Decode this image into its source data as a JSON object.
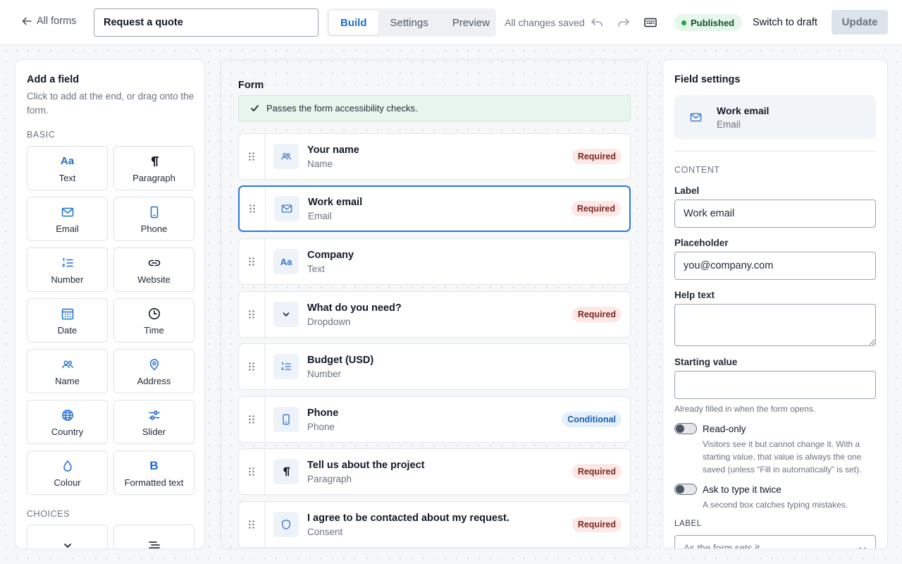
{
  "topbar": {
    "back_label": "All forms",
    "form_title": "Request a quote",
    "tabs": [
      {
        "label": "Build"
      },
      {
        "label": "Settings"
      },
      {
        "label": "Preview"
      }
    ],
    "save_status": "All changes saved",
    "status_badge": "Published",
    "draft_label": "Switch to draft",
    "update_label": "Update"
  },
  "colors": {
    "accent": "#1d6fd1",
    "published": "#22a34a",
    "required_bg": "#fde8e6",
    "conditional_bg": "#e6f0fb"
  },
  "add_field": {
    "title": "Add a field",
    "subtitle": "Click to add at the end, or drag onto the form.",
    "basic_label": "BASIC",
    "basic": [
      {
        "label": "Text",
        "icon": "text-icon"
      },
      {
        "label": "Paragraph",
        "icon": "paragraph-icon"
      },
      {
        "label": "Email",
        "icon": "email-icon"
      },
      {
        "label": "Phone",
        "icon": "phone-icon"
      },
      {
        "label": "Number",
        "icon": "number-icon"
      },
      {
        "label": "Website",
        "icon": "link-icon"
      },
      {
        "label": "Date",
        "icon": "calendar-icon"
      },
      {
        "label": "Time",
        "icon": "clock-icon"
      },
      {
        "label": "Name",
        "icon": "people-icon"
      },
      {
        "label": "Address",
        "icon": "pin-icon"
      },
      {
        "label": "Country",
        "icon": "globe-icon"
      },
      {
        "label": "Slider",
        "icon": "slider-icon"
      },
      {
        "label": "Colour",
        "icon": "drop-icon"
      },
      {
        "label": "Formatted text",
        "icon": "bold-icon"
      }
    ],
    "choices_label": "CHOICES",
    "choices": [
      {
        "label": "",
        "icon": "chevron-down-icon"
      },
      {
        "label": "",
        "icon": "list-icon"
      }
    ]
  },
  "form": {
    "title": "Form",
    "a11y_message": "Passes the form accessibility checks.",
    "fields": [
      {
        "label": "Your name",
        "type": "Name",
        "badge": "Required",
        "icon": "people-icon"
      },
      {
        "label": "Work email",
        "type": "Email",
        "badge": "Required",
        "icon": "email-icon"
      },
      {
        "label": "Company",
        "type": "Text",
        "badge": "",
        "icon": "text-icon"
      },
      {
        "label": "What do you need?",
        "type": "Dropdown",
        "badge": "Required",
        "icon": "chevron-down-icon"
      },
      {
        "label": "Budget (USD)",
        "type": "Number",
        "badge": "",
        "icon": "number-icon"
      },
      {
        "label": "Phone",
        "type": "Phone",
        "badge": "Conditional",
        "icon": "phone-icon"
      },
      {
        "label": "Tell us about the project",
        "type": "Paragraph",
        "badge": "Required",
        "icon": "paragraph-icon"
      },
      {
        "label": "I agree to be contacted about my request.",
        "type": "Consent",
        "badge": "Required",
        "icon": "shield-icon"
      }
    ]
  },
  "settings": {
    "title": "Field settings",
    "selected_label": "Work email",
    "selected_type": "Email",
    "content_label": "CONTENT",
    "label_label": "Label",
    "label_value": "Work email",
    "placeholder_label": "Placeholder",
    "placeholder_value": "you@company.com",
    "help_label": "Help text",
    "starting_label": "Starting value",
    "starting_hint": "Already filled in when the form opens.",
    "readonly_label": "Read-only",
    "readonly_desc": "Visitors see it but cannot change it. With a starting value, that value is always the one saved (unless “Fill in automatically” is set).",
    "twice_label": "Ask to type it twice",
    "twice_desc": "A second box catches typing mistakes.",
    "confirm_label": "LABEL",
    "confirm_value": "As the form sets it"
  }
}
